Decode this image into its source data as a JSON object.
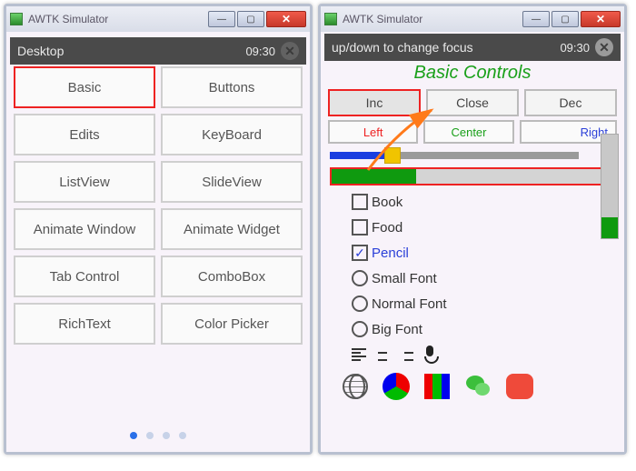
{
  "left": {
    "window_title": "AWTK Simulator",
    "appbar_title": "Desktop",
    "clock": "09:30",
    "tiles": [
      "Basic",
      "Buttons",
      "Edits",
      "KeyBoard",
      "ListView",
      "SlideView",
      "Animate Window",
      "Animate Widget",
      "Tab Control",
      "ComboBox",
      "RichText",
      "Color Picker"
    ],
    "focused_index": 0,
    "page_dots": 4,
    "active_dot": 0
  },
  "right": {
    "window_title": "AWTK Simulator",
    "appbar_title": "up/down to change focus",
    "clock": "09:30",
    "heading": "Basic Controls",
    "buttons": [
      "Inc",
      "Close",
      "Dec"
    ],
    "focused_button": 0,
    "tabs": [
      "Left",
      "Center",
      "Right"
    ],
    "slider_value_pct": 22,
    "progress_value_pct": 30,
    "vprogress_value_pct": 20,
    "checks": [
      {
        "label": "Book",
        "checked": false
      },
      {
        "label": "Food",
        "checked": false
      },
      {
        "label": "Pencil",
        "checked": true
      }
    ],
    "radios": [
      "Small Font",
      "Normal Font",
      "Big Font"
    ],
    "align_icons": [
      "align-left",
      "align-center",
      "align-right"
    ],
    "extra_icons": [
      "mic"
    ],
    "bottom_icons": [
      "globe",
      "tricolor-circle",
      "tricolor-square",
      "wechat",
      "red-rounded"
    ]
  },
  "colors": {
    "focus_red": "#e22",
    "green": "#0f9a0f",
    "blue": "#1a3ee0",
    "yellow": "#f0c400"
  }
}
